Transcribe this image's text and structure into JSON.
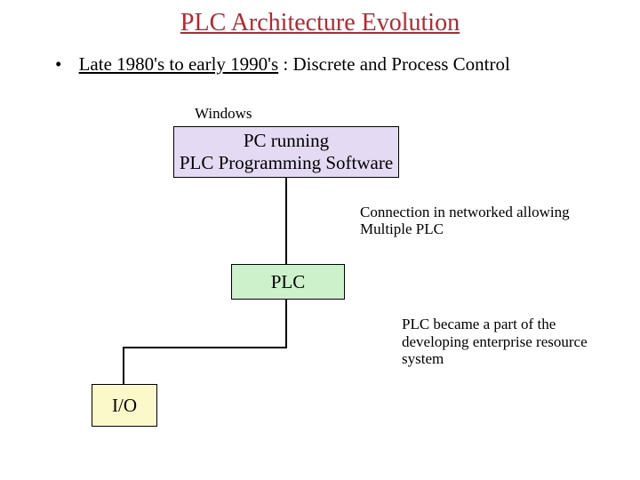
{
  "title": "PLC Architecture Evolution",
  "bullet": {
    "era": "Late 1980's to early 1990's",
    "sep": " :  ",
    "desc": "Discrete and Process Control"
  },
  "labels": {
    "windows": "Windows"
  },
  "boxes": {
    "pc_line1": "PC running",
    "pc_line2": "PLC Programming Software",
    "plc": "PLC",
    "io": "I/O"
  },
  "notes": {
    "n1a": "Connection in networked allowing",
    "n1b": " Multiple PLC",
    "n2": "PLC became a part of the developing enterprise resource system"
  }
}
